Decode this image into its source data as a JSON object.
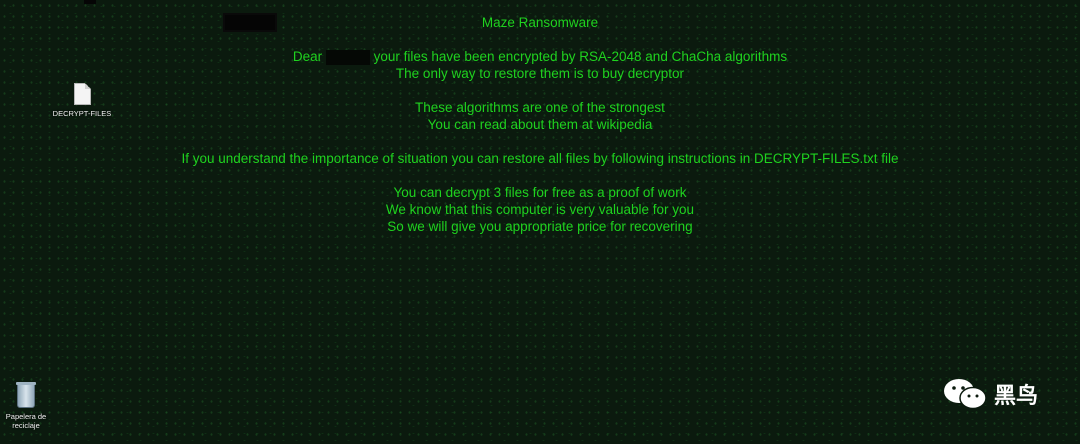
{
  "note": {
    "title": "Maze Ransomware",
    "dear": "Dear",
    "line_encrypted": "your files have been encrypted by RSA-2048 and ChaCha algorithms",
    "line_only_way": "The only way to restore them is to buy decryptor",
    "line_strongest": "These algorithms are one of the strongest",
    "line_wikipedia": "You can read about them at wikipedia",
    "line_instructions": "If you understand the importance of situation you can restore all files by following instructions in DECRYPT-FILES.txt file",
    "line_free": "You can decrypt 3 files for free as a proof of work",
    "line_valuable": "We know that this computer is very valuable for you",
    "line_price": "So we will give you appropriate price for recovering"
  },
  "desktop": {
    "file_icon_label": "DECRYPT-FILES",
    "bin_icon_label": "Papelera de reciclaje"
  },
  "watermark": {
    "text": "黑鸟"
  },
  "colors": {
    "text": "#1fd21f",
    "background": "#0b1a0e"
  }
}
